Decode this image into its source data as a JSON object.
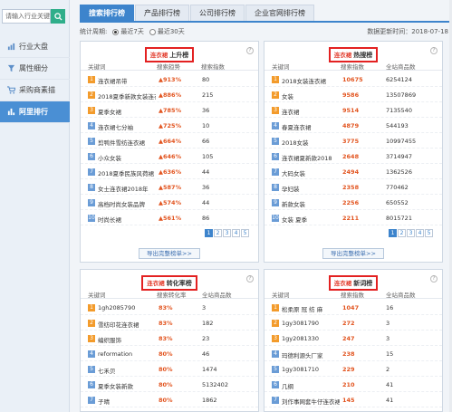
{
  "sidebar": {
    "search_placeholder": "请输入行业关键词",
    "items": [
      {
        "label": "行业大盘",
        "icon": "chart-icon"
      },
      {
        "label": "属性细分",
        "icon": "filter-icon"
      },
      {
        "label": "采购商素描",
        "icon": "cart-icon"
      },
      {
        "label": "阿里排行",
        "icon": "ranking-icon"
      }
    ]
  },
  "tabs": [
    {
      "label": "搜索排行榜"
    },
    {
      "label": "产品排行榜"
    },
    {
      "label": "公司排行榜"
    },
    {
      "label": "企业官网排行榜"
    }
  ],
  "filter": {
    "label": "统计周期:",
    "option_7": "最近7天",
    "option_30": "最近30天"
  },
  "update_label": "数据更新时间：2018-07-18",
  "accent_color": "#3d84cc",
  "panels": {
    "rising": {
      "brand": "连衣裙",
      "title": "上升榜",
      "cols": [
        "关键词",
        "搜索趋势",
        "搜索指数"
      ],
      "rows": [
        {
          "rank": "1",
          "keyword": "连衣裙吊带",
          "trend": "▲913%",
          "value": "80"
        },
        {
          "rank": "2",
          "keyword": "2018夏季新款女装连衣裙",
          "trend": "▲886%",
          "value": "215"
        },
        {
          "rank": "3",
          "keyword": "夏季女裙",
          "trend": "▲785%",
          "value": "36"
        },
        {
          "rank": "4",
          "keyword": "连衣裙七分袖",
          "trend": "▲725%",
          "value": "10"
        },
        {
          "rank": "5",
          "keyword": "剪鸭件雪纺连衣裙",
          "trend": "▲664%",
          "value": "66"
        },
        {
          "rank": "6",
          "keyword": "小众女装",
          "trend": "▲646%",
          "value": "105"
        },
        {
          "rank": "7",
          "keyword": "2018夏季民族风荷裙",
          "trend": "▲636%",
          "value": "44"
        },
        {
          "rank": "8",
          "keyword": "女士连衣裙2018年",
          "trend": "▲587%",
          "value": "36"
        },
        {
          "rank": "9",
          "keyword": "高档时尚女装品牌",
          "trend": "▲574%",
          "value": "44"
        },
        {
          "rank": "10",
          "keyword": "时尚长裙",
          "trend": "▲561%",
          "value": "86"
        }
      ],
      "pages": [
        "1",
        "2",
        "3",
        "4",
        "5"
      ],
      "export": "导出完整榜单>>"
    },
    "hot": {
      "brand": "连衣裙",
      "title": "热搜榜",
      "cols": [
        "关键词",
        "搜索指数",
        "全站商品数"
      ],
      "rows": [
        {
          "rank": "1",
          "keyword": "2018女装连衣裙",
          "index": "10675",
          "count": "6254124"
        },
        {
          "rank": "2",
          "keyword": "女装",
          "index": "9586",
          "count": "13507869"
        },
        {
          "rank": "3",
          "keyword": "连衣裙",
          "index": "9514",
          "count": "7135540"
        },
        {
          "rank": "4",
          "keyword": "春夏连衣裙",
          "index": "4879",
          "count": "544193"
        },
        {
          "rank": "5",
          "keyword": "2018女装",
          "index": "3775",
          "count": "10997455"
        },
        {
          "rank": "6",
          "keyword": "连衣裙夏新款2018",
          "index": "2648",
          "count": "3714947"
        },
        {
          "rank": "7",
          "keyword": "大码女装",
          "index": "2494",
          "count": "1362526"
        },
        {
          "rank": "8",
          "keyword": "孕妇装",
          "index": "2358",
          "count": "770462"
        },
        {
          "rank": "9",
          "keyword": "新款女装",
          "index": "2256",
          "count": "650552"
        },
        {
          "rank": "10",
          "keyword": "女装 夏季",
          "index": "2211",
          "count": "8015721"
        }
      ],
      "pages": [
        "1",
        "2",
        "3",
        "4",
        "5"
      ],
      "export": "导出完整榜单>>"
    },
    "conversion": {
      "brand": "连衣裙",
      "title": "转化率榜",
      "cols": [
        "关键词",
        "搜索转化率",
        "全站商品数"
      ],
      "rows": [
        {
          "rank": "1",
          "keyword": "1gh2085790",
          "rate": "83%",
          "count": "3"
        },
        {
          "rank": "2",
          "keyword": "雪纺印花连衣裙",
          "rate": "83%",
          "count": "182"
        },
        {
          "rank": "3",
          "keyword": "编织服饰",
          "rate": "83%",
          "count": "23"
        },
        {
          "rank": "4",
          "keyword": "reformation",
          "rate": "80%",
          "count": "46"
        },
        {
          "rank": "5",
          "keyword": "七禾贝",
          "rate": "80%",
          "count": "1474"
        },
        {
          "rank": "6",
          "keyword": "夏季女装新款",
          "rate": "80%",
          "count": "5132402"
        },
        {
          "rank": "7",
          "keyword": "子晴",
          "rate": "80%",
          "count": "1862"
        }
      ]
    },
    "new": {
      "brand": "连衣裙",
      "title": "新词榜",
      "cols": [
        "关键词",
        "搜索指数",
        "全站商品数"
      ],
      "rows": [
        {
          "rank": "1",
          "keyword": "松柔原 冠 纺 麻",
          "index": "1047",
          "count": "16"
        },
        {
          "rank": "2",
          "keyword": "1gy3081790",
          "index": "272",
          "count": "3"
        },
        {
          "rank": "3",
          "keyword": "1gy2081330",
          "index": "247",
          "count": "3"
        },
        {
          "rank": "4",
          "keyword": "玛德利源头厂家",
          "index": "238",
          "count": "15"
        },
        {
          "rank": "5",
          "keyword": "1gy3081710",
          "index": "229",
          "count": "2"
        },
        {
          "rank": "6",
          "keyword": "几纲",
          "index": "210",
          "count": "41"
        },
        {
          "rank": "7",
          "keyword": "刘作事网套牛仔连衣裙",
          "index": "145",
          "count": "41"
        }
      ]
    }
  }
}
